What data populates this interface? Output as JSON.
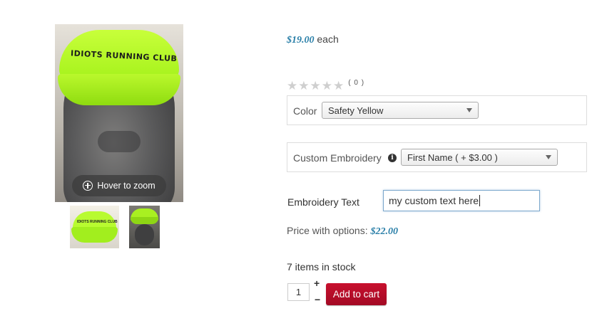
{
  "product": {
    "image_zoom_label": "Hover to zoom",
    "cap_text": "IDIOTS RUNNING CLUB",
    "thumb_text": "IDIOTS RUNNING CLUB"
  },
  "price": {
    "amount": "$19.00",
    "unit": "each"
  },
  "rating": {
    "stars_filled": 0,
    "stars_total": 5,
    "count": "( 0 )"
  },
  "options": {
    "color": {
      "label": "Color",
      "selected": "Safety Yellow"
    },
    "embroidery": {
      "label": "Custom Embroidery",
      "selected": "First Name ( + $3.00 )"
    }
  },
  "embroidery_text": {
    "label": "Embroidery Text",
    "value": "my custom text here"
  },
  "price_with_options": {
    "label": "Price with options:",
    "amount": "$22.00"
  },
  "stock": {
    "text": "7 items in stock"
  },
  "cart": {
    "quantity": "1",
    "plus": "+",
    "minus": "−",
    "button_label": "Add to cart"
  },
  "colors": {
    "accent": "#2a7fa8",
    "cart_button": "#c8102e",
    "cap": "#b8fb30"
  }
}
